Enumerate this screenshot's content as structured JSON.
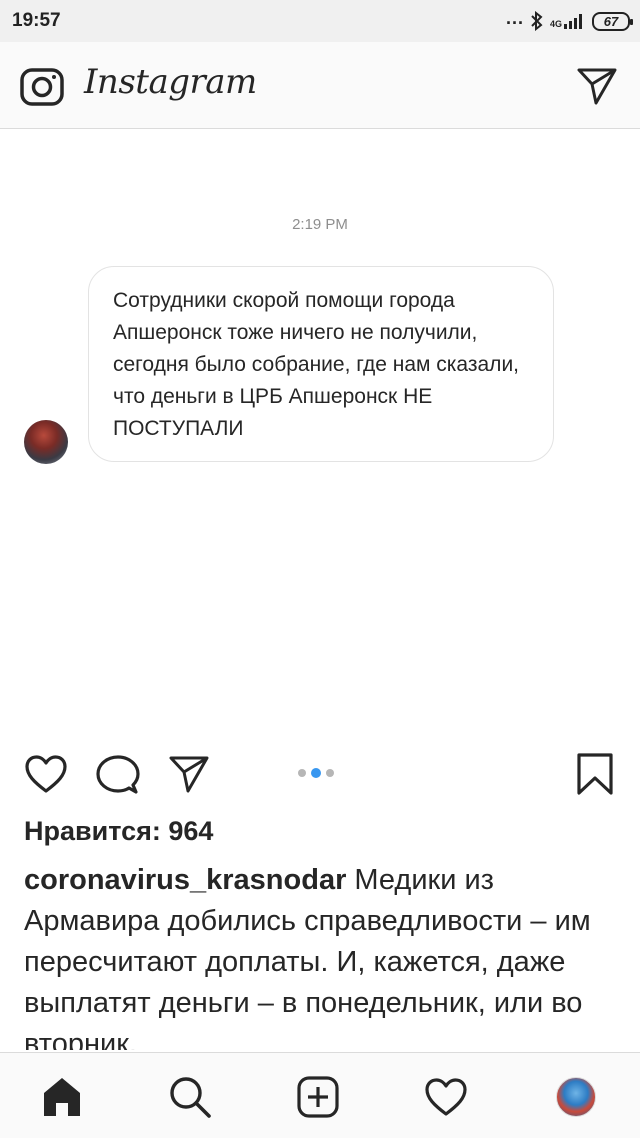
{
  "status_bar": {
    "time": "19:57",
    "dots": "...",
    "network": "4G",
    "battery": "67"
  },
  "header": {
    "brand": "Instagram"
  },
  "post": {
    "timestamp": "2:19 PM",
    "message": "Сотрудники скорой помощи города Апшеронск тоже ничего не получили, сегодня было собрание, где нам сказали, что деньги в ЦРБ Апшеронск НЕ ПОСТУПАЛИ"
  },
  "carousel": {
    "count": 3,
    "active": 2
  },
  "likes_text": "Нравится: 964",
  "caption": {
    "username": "coronavirus_krasnodar",
    "text": "Медики из Армавира добились справедливости – им пересчитают доплаты. И, кажется, даже выплатят деньги – в понедельник, или во вторник."
  },
  "colors": {
    "accent": "#3897f0",
    "text": "#262626",
    "secondary": "#8e8e8e"
  },
  "icons": [
    "camera-icon",
    "direct-icon",
    "heart-icon",
    "comment-icon",
    "share-icon",
    "bookmark-icon",
    "home-icon",
    "search-icon",
    "add-icon",
    "activity-icon"
  ]
}
